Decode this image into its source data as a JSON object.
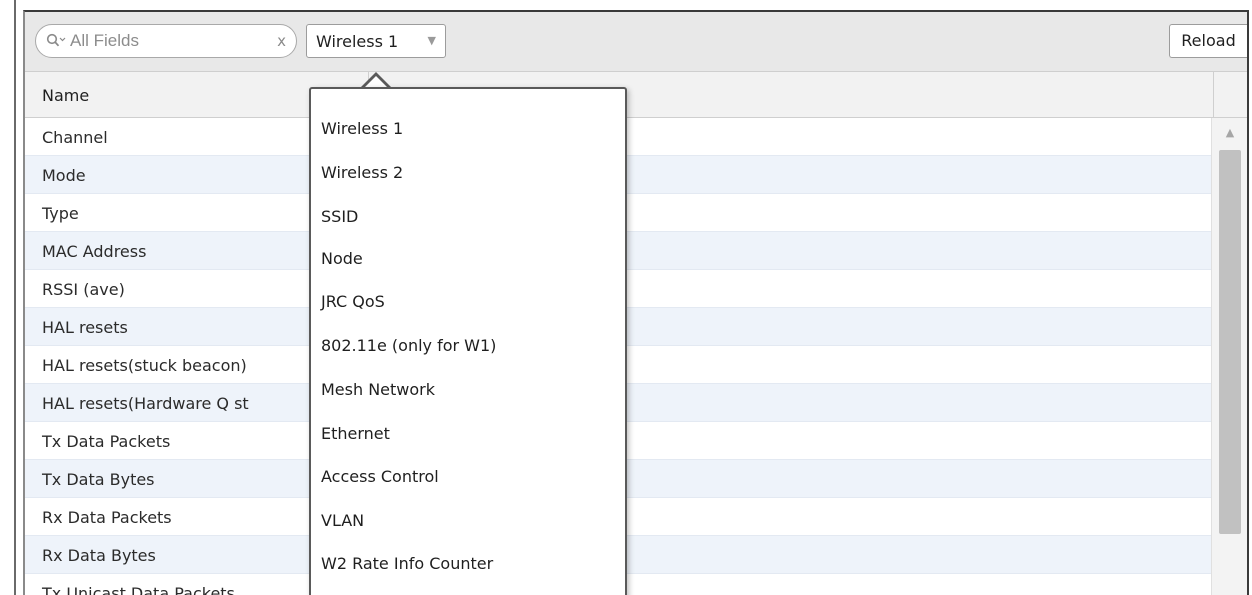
{
  "search": {
    "placeholder": "All Fields",
    "clear_label": "x"
  },
  "selector": {
    "selected": "Wireless 1"
  },
  "toolbar": {
    "reload_label": "Reload"
  },
  "table": {
    "column_name_header": "Name",
    "rows": [
      "Channel",
      "Mode",
      "Type",
      "MAC Address",
      "RSSI (ave)",
      "HAL resets",
      "HAL resets(stuck beacon)",
      "HAL resets(Hardware Q st",
      "Tx Data Packets",
      "Tx Data Bytes",
      "Rx Data Packets",
      "Rx Data Bytes",
      "Tx Unicast Data Packets"
    ]
  },
  "dropdown": {
    "options": [
      "Wireless 1",
      "Wireless 2",
      "SSID",
      "Node",
      "JRC QoS",
      "802.11e (only for W1)",
      "Mesh Network",
      "Ethernet",
      "Access Control",
      "VLAN",
      "W2 Rate Info Counter"
    ]
  },
  "colors": {
    "toolbar_bg": "#e8e8e8",
    "row_alt_bg": "#eef3fa",
    "menu_border": "#5a5a5a"
  }
}
